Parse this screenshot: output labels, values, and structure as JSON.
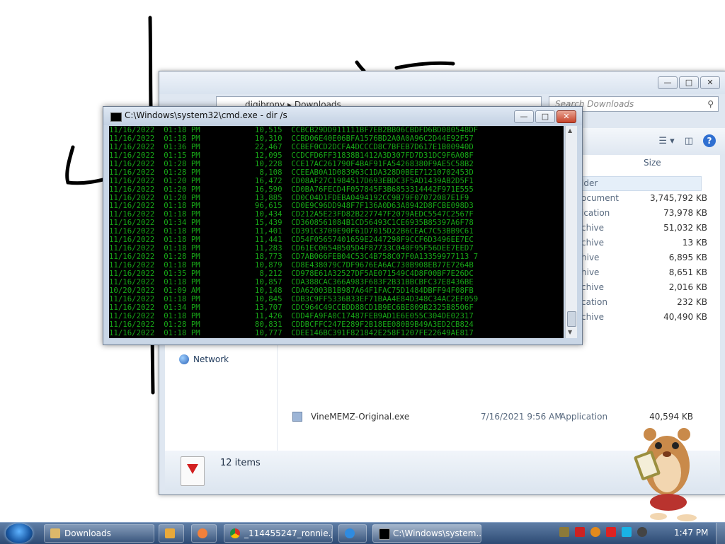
{
  "explorer": {
    "address": "digibrony ▸ Downloads",
    "search_placeholder": "Search Downloads",
    "size_header": "Size",
    "nav_network": "Network",
    "items_count": "12 items",
    "rows": [
      {
        "type": "lder",
        "size": ""
      },
      {
        "type": "ocument",
        "size": "3,745,792 KB"
      },
      {
        "type": "ication",
        "size": "73,978 KB"
      },
      {
        "type": "chive",
        "size": "51,032 KB"
      },
      {
        "type": "chive",
        "size": "13 KB"
      },
      {
        "type": "hive",
        "size": "6,895 KB"
      },
      {
        "type": "hive",
        "size": "8,651 KB"
      },
      {
        "type": "chive",
        "size": "2,016 KB"
      },
      {
        "type": "cation",
        "size": "232 KB"
      },
      {
        "type": "chive",
        "size": "40,490 KB"
      }
    ],
    "top_size": "3,745,792 KB",
    "last_row": {
      "name": "VineMEMZ-Original.exe",
      "date": "7/16/2021 9:56 AM",
      "type": "Application",
      "size": "40,594 KB"
    }
  },
  "cmd": {
    "title": "C:\\Windows\\system32\\cmd.exe - dir  /s",
    "lines": [
      "11/16/2022  01:18 PM            10,515  CCBCB29DD911111BF7EB2BB06CBDFD6BD080548DF",
      "11/16/2022  01:18 PM            10,310  CCBD06E40E06BFA1576BD2A0A0A96C2D44E92F57",
      "11/16/2022  01:36 PM            22,467  CCBEF0CD2DCFA4DCCCD8C7BFEB7D617E1B00940D",
      "11/16/2022  01:15 PM            12,095  CCDCFD6FF31838B1412A3D307FD7D31DC9F6A08F",
      "11/16/2022  01:28 PM            10,228  CCE17AC261790F4BAF91FA54268380F9AE5C58B2",
      "11/16/2022  01:28 PM             8,108  CCEEAB0A1D083963C1DA328D0BEE71210702453D",
      "11/16/2022  01:20 PM            16,472  CD08AF27C1984517D693EBDC3F5AD1439AB2D5F1",
      "11/16/2022  01:20 PM            16,590  CD0BA76FECD4F057845F3B6853314442F971E555",
      "11/16/2022  01:20 PM            13,885  CD0C04D1FDEBA0494192CC9B79F07072087E1F9",
      "11/16/2022  01:18 PM            96,615  CD0E9C96DD948F7F136A0D63A8942D8FCBE098D3",
      "11/16/2022  01:18 PM            10,434  CD212A5E23FD82B227747F2079AEDC5547C2567F",
      "11/16/2022  01:34 PM            15,439  CD3608561084B1CD56493C1CE6935B85397A6F78",
      "11/16/2022  01:18 PM            11,401  CD391C3709E90F61D7015D22B6CEAC7C53BB9C61",
      "11/16/2022  01:18 PM            11,441  CD54F05657401659E2447298F9CCF6D3496EE7EC",
      "11/16/2022  01:18 PM            11,283  CD61EC0654B505D4F87733C040F95F56DEE7EED7",
      "11/16/2022  01:28 PM            18,773  CD7AB066FEB04C53C4B758C07F0A13359977113 7",
      "11/16/2022  01:18 PM            10,879  CD8E438079C7DF9676EA6AC730B908EB77E7264B",
      "11/16/2022  01:35 PM             8,212  CD978E61A32527DF5AE071549C4D8F00BF7E26DC",
      "11/16/2022  01:18 PM            10,857  CDA388CAC366A983F683F2B31BBCBFC37E8436BE",
      "10/20/2022  01:09 AM            10,148  CDA62003B1B987A64F1FAC75D1484DBFF94F08FB",
      "11/16/2022  01:18 PM            10,845  CDB3C9FF5336B33EF71BAA4E84D348C34AC2EF059",
      "11/16/2022  01:34 PM            13,707  CDC964C49CCBDD88CD1B9EC6BE809B2325B8506F",
      "11/16/2022  01:18 PM            11,426  CDD4FA9FA0C17487FEB9AD1E6E055C304DE02317",
      "11/16/2022  01:28 PM            80,831  CDDBCFFC247E289F2B18EE080B9B49A3ED2CB824",
      "11/16/2022  01:18 PM            10,777  CDEE146BC391F821842E258F1207FE22649AE817"
    ]
  },
  "taskbar": {
    "buttons": [
      {
        "label": "Downloads"
      },
      {
        "label": ""
      },
      {
        "label": ""
      },
      {
        "label": "_114455247_ronnie.jp..."
      },
      {
        "label": ""
      },
      {
        "label": "C:\\Windows\\system..."
      }
    ],
    "clock": "1:47 PM"
  },
  "colors": {
    "console_text": "#17a517",
    "taskbar": "#2d4a73"
  },
  "icons": [
    "globe-icon",
    "cmd-icon",
    "chrome-icon",
    "ie-icon",
    "folder-icon",
    "media-player-icon",
    "paint-icon"
  ]
}
